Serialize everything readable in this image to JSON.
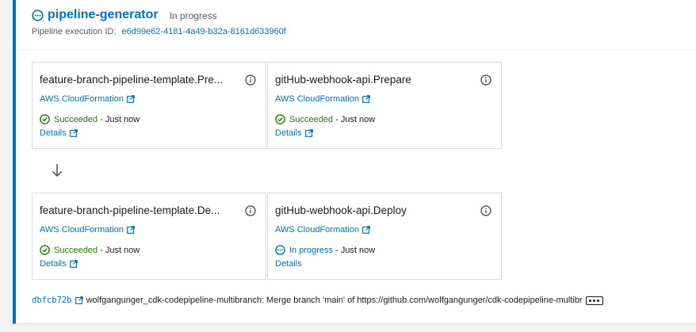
{
  "stage": {
    "title": "pipeline-generator",
    "status": "In progress",
    "execution_label": "Pipeline execution ID:",
    "execution_id": "e6d99e62-4181-4a49-b32a-8161d633960f",
    "status_icon": "in-progress-icon"
  },
  "actions": [
    {
      "title": "feature-branch-pipeline-template.Pre...",
      "provider": "AWS CloudFormation",
      "status": "Succeeded",
      "status_time": "- Just now",
      "details": "Details",
      "status_icon": "success-check-icon"
    },
    {
      "title": "gitHub-webhook-api.Prepare",
      "provider": "AWS CloudFormation",
      "status": "Succeeded",
      "status_time": "- Just now",
      "details": "Details",
      "status_icon": "success-check-icon"
    },
    {
      "title": "feature-branch-pipeline-template.De...",
      "provider": "AWS CloudFormation",
      "status": "Succeeded",
      "status_time": "- Just now",
      "details": "Details",
      "status_icon": "success-check-icon"
    },
    {
      "title": "gitHub-webhook-api.Deploy",
      "provider": "AWS CloudFormation",
      "status": "In progress",
      "status_time": "- Just now",
      "details": "Details",
      "status_icon": "in-progress-icon"
    }
  ],
  "commit": {
    "id": "dbfcb72b",
    "message": "wolfgangunger_cdk-codepipeline-multibranch: Merge branch 'main' of https://github.com/wolfgangunger/cdk-codepipeline-multibr"
  },
  "colors": {
    "accent": "#0073bb",
    "success": "#1d8102",
    "border": "#d5dbdb"
  }
}
